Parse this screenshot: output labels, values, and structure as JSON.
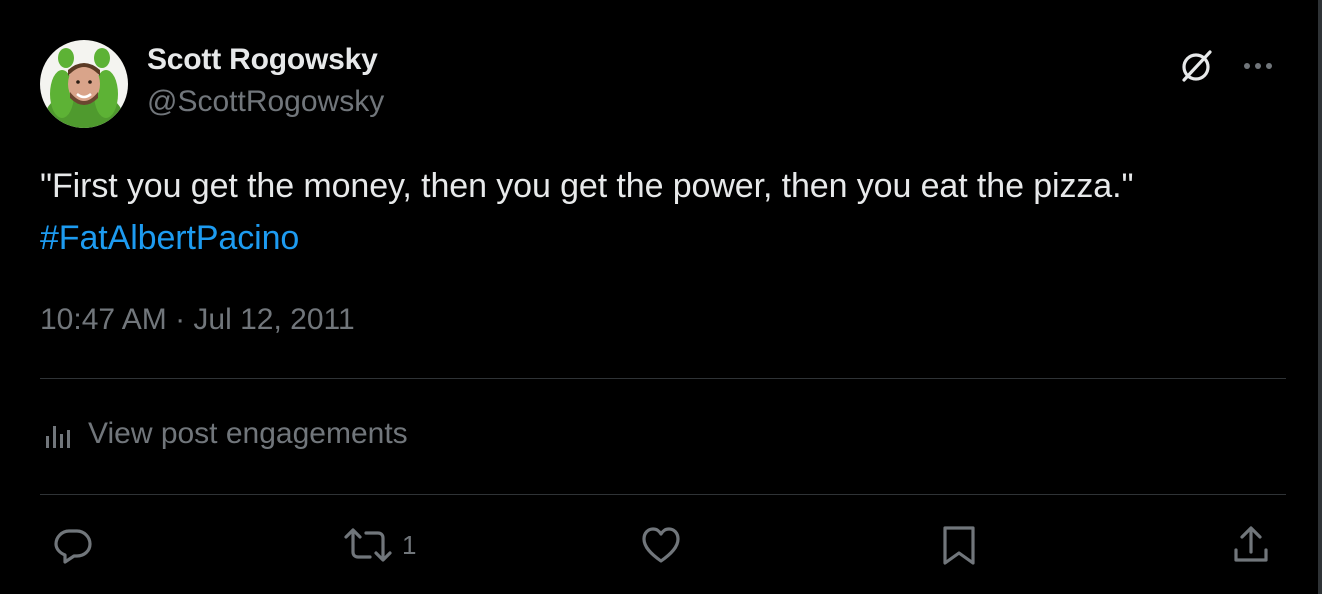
{
  "author": {
    "display_name": "Scott Rogowsky",
    "handle": "@ScottRogowsky",
    "avatar_icon": "profile-photo"
  },
  "header_actions": {
    "grok_icon": "slashed-circle-icon",
    "more_icon": "more-horizontal-icon"
  },
  "tweet": {
    "text": "\"First you get the money, then you get the power, then you eat the pizza.\"",
    "hashtag": "#FatAlbertPacino",
    "timestamp": "10:47 AM · Jul 12, 2011"
  },
  "engagements": {
    "label": "View post engagements",
    "icon": "bar-chart-icon"
  },
  "actions": {
    "reply": {
      "icon": "reply-icon",
      "count": ""
    },
    "repost": {
      "icon": "repost-icon",
      "count": "1"
    },
    "like": {
      "icon": "heart-icon",
      "count": ""
    },
    "bookmark": {
      "icon": "bookmark-icon",
      "count": ""
    },
    "share": {
      "icon": "share-icon",
      "count": ""
    }
  },
  "colors": {
    "background": "#000000",
    "text_primary": "#e7e9ea",
    "text_secondary": "#71767b",
    "link": "#1d9bf0",
    "divider": "#2f3336"
  }
}
